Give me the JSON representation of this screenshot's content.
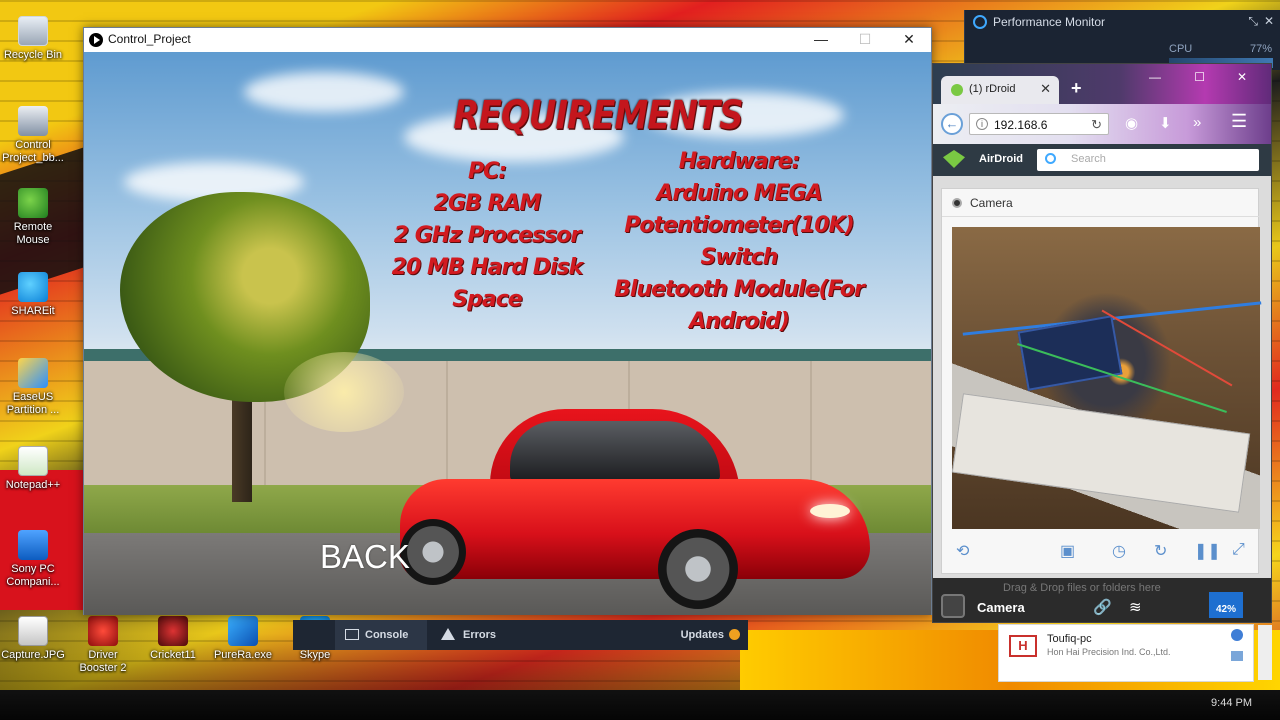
{
  "desktop": {
    "icons": [
      {
        "label": "Recycle Bin",
        "icon": "recycle-bin-icon"
      },
      {
        "label": "Control Project_bb...",
        "icon": "control-project-icon"
      },
      {
        "label": "Remote Mouse",
        "icon": "remote-mouse-icon"
      },
      {
        "label": "SHAREit",
        "icon": "shareit-icon"
      },
      {
        "label": "EaseUS Partition ...",
        "icon": "easeus-icon"
      },
      {
        "label": "Notepad++",
        "icon": "notepad-plus-plus-icon"
      },
      {
        "label": "Sony PC Compani...",
        "icon": "sony-pc-companion-icon"
      },
      {
        "label": "Capture.JPG",
        "icon": "image-file-icon"
      },
      {
        "label": "Driver Booster 2",
        "icon": "driver-booster-icon"
      },
      {
        "label": "Cricket11",
        "icon": "cricket11-icon"
      },
      {
        "label": "PureRa.exe",
        "icon": "purera-exe-icon"
      },
      {
        "label": "Skype",
        "icon": "skype-icon"
      }
    ],
    "clock": "9:44 PM"
  },
  "perf_monitor": {
    "title": "Performance Monitor",
    "cpu_label": "CPU",
    "cpu_percent": "77%"
  },
  "app_window": {
    "title": "Control_Project",
    "requirements": {
      "heading": "REQUIREMENTS",
      "pc": [
        "PC:",
        "2GB RAM",
        "2 GHz Processor",
        "20 MB Hard Disk Space"
      ],
      "hardware": [
        "Hardware:",
        "Arduino MEGA",
        "Potentiometer(10K)",
        "Switch",
        "Bluetooth Module(For Android)"
      ]
    },
    "back_label": "BACK"
  },
  "console_bar": {
    "console_label": "Console",
    "errors_label": "Errors",
    "updates_label": "Updates"
  },
  "browser": {
    "tab_title": "(1) rDroid",
    "url": "192.168.6",
    "airdroid": {
      "brand": "AirDroid",
      "search_placeholder": "Search",
      "camera_title": "Camera",
      "footer_hint": "Drag & Drop files or folders here",
      "footer_title": "Camera",
      "battery": "42%"
    }
  },
  "device_card": {
    "name": "Toufiq-pc",
    "vendor": "Hon Hai Precision Ind. Co.,Ltd."
  }
}
